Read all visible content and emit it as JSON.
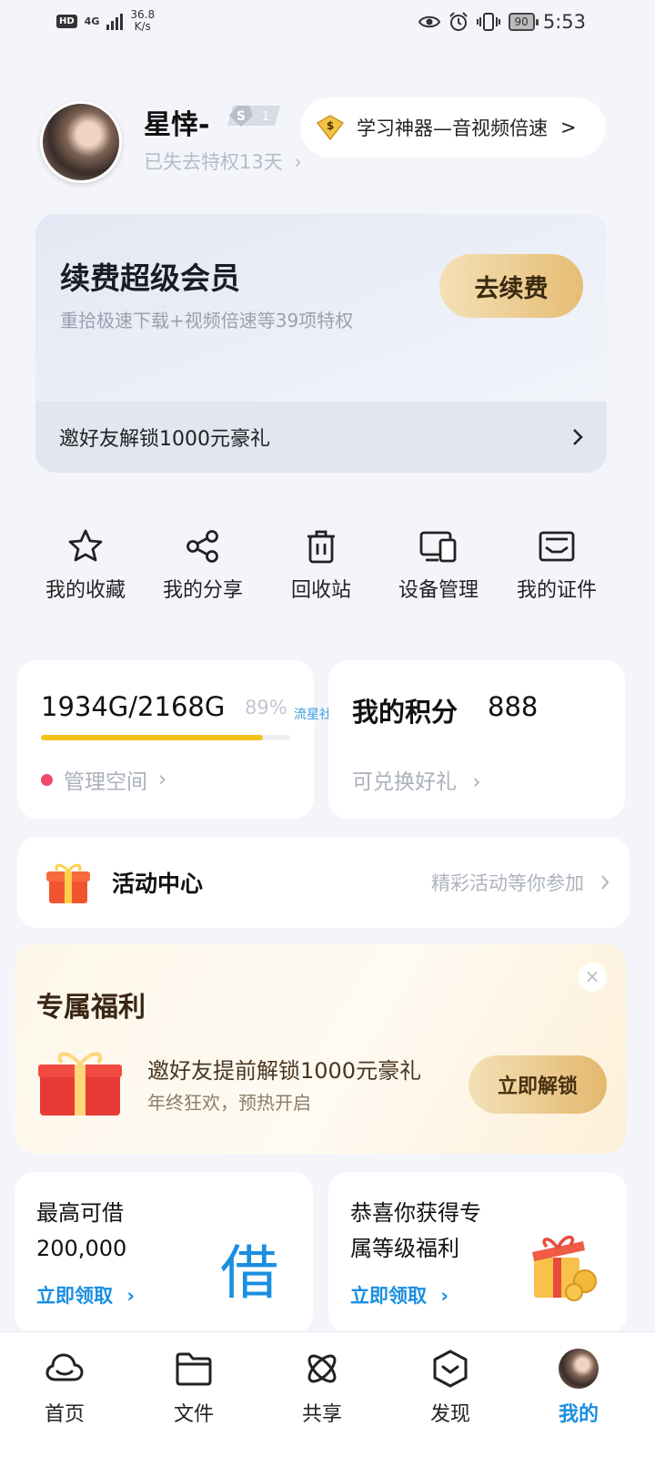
{
  "status_bar": {
    "hd": "HD",
    "network_type": "4G",
    "speed": "36.8",
    "speed_unit": "K/s",
    "battery": "90",
    "time": "5:53"
  },
  "profile": {
    "username": "星悻-",
    "level": "1",
    "expire_text": "已失去特权13天",
    "promo_text": "学习神器—音视频倍速"
  },
  "vip": {
    "title": "续费超级会员",
    "subtitle": "重拾极速下载+视频倍速等39项特权",
    "renew_label": "去续费",
    "invite_text": "邀好友解锁1000元豪礼"
  },
  "quick_actions": [
    {
      "label": "我的收藏",
      "icon": "star-icon"
    },
    {
      "label": "我的分享",
      "icon": "share-icon"
    },
    {
      "label": "回收站",
      "icon": "trash-icon"
    },
    {
      "label": "设备管理",
      "icon": "devices-icon"
    },
    {
      "label": "我的证件",
      "icon": "id-card-icon"
    }
  ],
  "storage": {
    "usage_text": "1934G/2168G",
    "percent_text": "89%",
    "percent_value": 89,
    "manage_label": "管理空间"
  },
  "watermark": "流星社区",
  "points": {
    "title": "我的积分",
    "value": "888",
    "subtitle": "可兑换好礼"
  },
  "activity": {
    "title": "活动中心",
    "subtitle": "精彩活动等你参加"
  },
  "benefit": {
    "title": "专属福利",
    "main": "邀好友提前解锁1000元豪礼",
    "sub": "年终狂欢，预热开启",
    "button": "立即解锁"
  },
  "loan_tile": {
    "line1": "最高可借",
    "line2": "200,000",
    "link": "立即领取",
    "glyph": "借"
  },
  "gift_tile": {
    "line1": "恭喜你获得专",
    "line2": "属等级福利",
    "link": "立即领取"
  },
  "nav": [
    {
      "label": "首页",
      "icon": "cloud-icon"
    },
    {
      "label": "文件",
      "icon": "folder-icon"
    },
    {
      "label": "共享",
      "icon": "atom-icon"
    },
    {
      "label": "发现",
      "icon": "compass-icon"
    },
    {
      "label": "我的",
      "icon": "avatar",
      "active": true
    }
  ],
  "colors": {
    "accent": "#1a8ee1",
    "gold": "#e6bd74",
    "progress": "#f1c21b",
    "dot": "#ef4a6b"
  }
}
